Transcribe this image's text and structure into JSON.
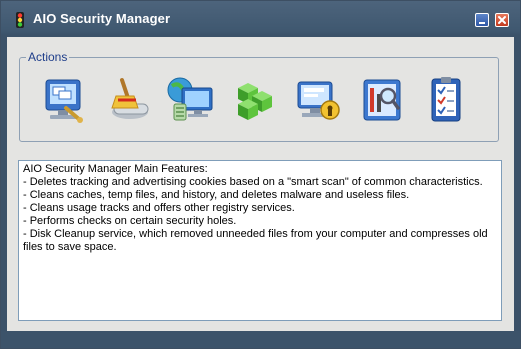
{
  "window": {
    "title": "AIO Security Manager",
    "icon": "traffic-light-icon",
    "controls": [
      "minimize-icon",
      "close-icon"
    ]
  },
  "actions": {
    "label": "Actions",
    "buttons": [
      {
        "icon": "computer-settings-icon"
      },
      {
        "icon": "broom-cleanup-icon"
      },
      {
        "icon": "internet-cleanup-icon"
      },
      {
        "icon": "registry-cubes-icon"
      },
      {
        "icon": "security-lock-icon"
      },
      {
        "icon": "system-tools-icon"
      },
      {
        "icon": "checklist-icon"
      }
    ]
  },
  "features": {
    "lines": [
      "AIO Security Manager Main Features:",
      "- Deletes tracking and advertising cookies based on a \"smart scan\" of common characteristics.",
      "- Cleans caches, temp files, and history, and deletes malware and useless files.",
      "- Cleans usage tracks and offers other registry services.",
      "- Performs checks on certain security holes.",
      "- Disk Cleanup service, which removed unneeded files from your computer and compresses old",
      "files to save space."
    ]
  },
  "colors": {
    "titlebar": "#3f5870",
    "client_bg": "#e4e4e2",
    "group_label": "#1f3e8a",
    "text_border": "#7f9db9"
  }
}
